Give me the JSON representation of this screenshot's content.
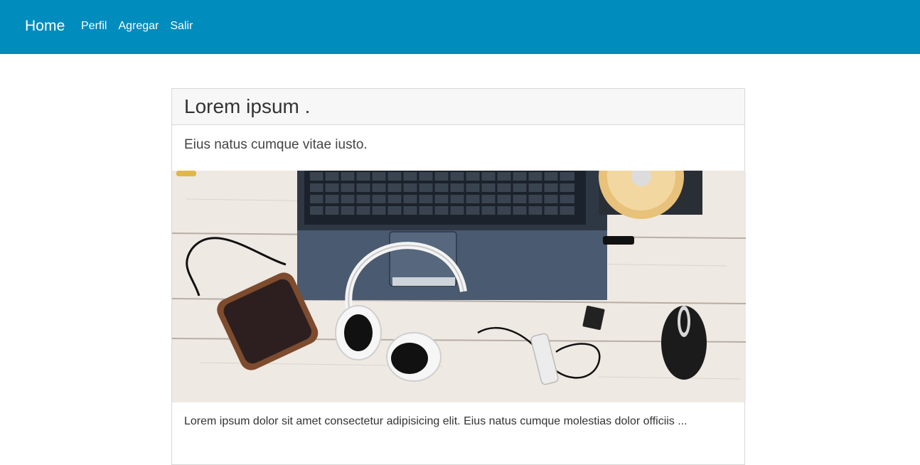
{
  "navbar": {
    "brand": "Home",
    "links": [
      "Perfil",
      "Agregar",
      "Salir"
    ],
    "background": "#008cbd"
  },
  "card": {
    "title": "Lorem ipsum .",
    "subtitle": "Eius natus cumque vitae iusto.",
    "image_description_icon": "product-photo",
    "body": "Lorem ipsum dolor sit amet consectetur adipisicing elit. Eius natus cumque molestias dolor officiis ..."
  }
}
